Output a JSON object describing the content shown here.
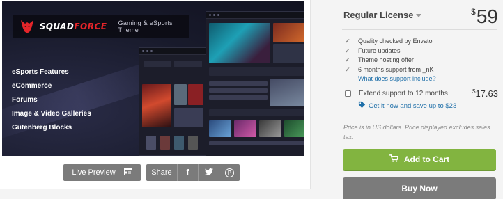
{
  "banner": {
    "brand_prefix": "SQUAD",
    "brand_suffix": "FORCE",
    "tagline": "Gaming & eSports Theme",
    "features": [
      "eSports Features",
      "eCommerce",
      "Forums",
      "Image & Video Galleries",
      "Gutenberg Blocks"
    ]
  },
  "toolbar": {
    "preview_label": "Live Preview",
    "share_label": "Share",
    "facebook_glyph": "f",
    "twitter_glyph": "t",
    "pinterest_glyph": "P"
  },
  "license": {
    "name": "Regular License",
    "currency": "$",
    "price": "59"
  },
  "included": [
    "Quality checked by Envato",
    "Future updates",
    "Theme hosting offer",
    "6 months support from _nK"
  ],
  "support_link": "What does support include?",
  "extend": {
    "label": "Extend support to 12 months",
    "currency": "$",
    "price": "17.63",
    "save_text": "Get it now and save up to $23"
  },
  "note": "Price is in US dollars. Price displayed excludes sales tax.",
  "cta": {
    "add_to_cart": "Add to Cart",
    "buy_now": "Buy Now"
  },
  "colors": {
    "add_to_cart": "#82b440",
    "buy_now": "#7b7b7b",
    "link": "#1d6ea8",
    "brand_red": "#e5252a"
  }
}
